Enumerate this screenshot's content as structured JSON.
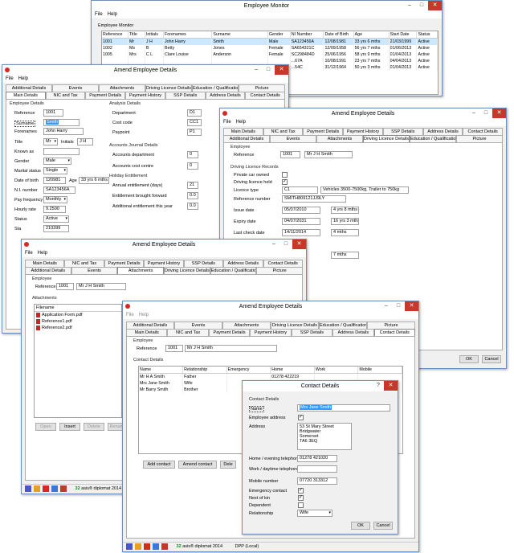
{
  "monitor": {
    "title": "Employee Monitor",
    "menu": [
      "File",
      "Help"
    ],
    "subtitle": "Employee Monitor",
    "columns": [
      "Reference",
      "Title",
      "Initials",
      "Forenames",
      "Surname",
      "Gender",
      "NI Number",
      "Date of Birth",
      "Age",
      "Start Date",
      "Status"
    ],
    "rows": [
      [
        "1001",
        "Mr",
        "J H",
        "John Harry",
        "Smith",
        "Male",
        "SA123456A",
        "12/08/1981",
        "33 yrs 6 mths",
        "21/03/1999",
        "Active"
      ],
      [
        "1002",
        "Ms",
        "B",
        "Betty",
        "Jones",
        "Female",
        "SA654321C",
        "12/09/1958",
        "56 yrs 7 mths",
        "01/06/2013",
        "Active"
      ],
      [
        "1005",
        "Mrs",
        "C L",
        "Clare Louise",
        "Anderson",
        "Female",
        "SC298484D",
        "25/06/1956",
        "58 yrs 9 mths",
        "01/04/2013",
        "Active"
      ],
      [
        "",
        "",
        "",
        "",
        "",
        "",
        "...67A",
        "10/08/1991",
        "23 yrs 7 mths",
        "04/04/2013",
        "Active"
      ],
      [
        "",
        "",
        "",
        "",
        "",
        "",
        "...54C",
        "31/12/1964",
        "50 yrs 3 mths",
        "01/04/2013",
        "Active"
      ]
    ]
  },
  "w1": {
    "title": "Amend Employee Details",
    "menu": [
      "File",
      "Help"
    ],
    "tabs1": [
      "Additional Details",
      "Events",
      "Attachments",
      "Driving Licence Details",
      "Education / Qualifications",
      "Picture"
    ],
    "tabs2": [
      "Main Details",
      "NIC and Tax",
      "Payment Details",
      "Payment History",
      "SSP Details",
      "Address Details",
      "Contact Details"
    ],
    "grp_employee": "Employee Details",
    "grp_analysis": "Analysis Details",
    "fields": [
      {
        "l": "Reference",
        "v": "1001"
      },
      {
        "l": "Surname",
        "v": "Smith"
      },
      {
        "l": "Forenames",
        "v": "John Harry"
      },
      {
        "l": "Title",
        "v": "Mr"
      },
      {
        "l": "Known as",
        "v": ""
      },
      {
        "l": "Gender",
        "v": "Male"
      },
      {
        "l": "Marital status",
        "v": "Single"
      },
      {
        "l": "Date of birth",
        "v": "120981"
      },
      {
        "l": "N.I. number",
        "v": "SA123456A"
      },
      {
        "l": "Pay frequency",
        "v": "Monthly"
      },
      {
        "l": "Hourly rate",
        "v": "9.2500"
      },
      {
        "l": "Status",
        "v": "Active"
      },
      {
        "l": "Sta",
        "v": "210399"
      }
    ],
    "initials_label": "Initials",
    "initials": "J H",
    "age_label": "Age",
    "age": "33 yrs 6 mths",
    "analysis": [
      {
        "l": "Department",
        "v": "D1"
      },
      {
        "l": "Cost code",
        "v": "CC1"
      },
      {
        "l": "Paypoint",
        "v": "P1"
      }
    ],
    "grp_journal": "Accounts Journal Details",
    "journal": [
      {
        "l": "Accounts department",
        "v": "0"
      },
      {
        "l": "Accounts cost centre",
        "v": "0"
      }
    ],
    "grp_holiday": "Holiday Entitlement",
    "holiday": [
      {
        "l": "Annual entitlement (days)",
        "v": "21"
      },
      {
        "l": "Entitlement brought forward",
        "v": "0.0"
      },
      {
        "l": "Additional entitlement this year",
        "v": "0.0"
      }
    ]
  },
  "w2": {
    "title": "Amend Employee Details",
    "menu": [
      "File",
      "Help"
    ],
    "tabs2": [
      "Main Details",
      "NIC and Tax",
      "Payment Details",
      "Payment History",
      "SSP Details",
      "Address Details",
      "Contact Details"
    ],
    "tabs1": [
      "Additional Details",
      "Events",
      "Attachments",
      "Driving Licence Details",
      "Education / Qualifications",
      "Picture"
    ],
    "grp_employee": "Employee",
    "ref_label": "Reference",
    "ref": "1001",
    "name": "Mr J H Smith",
    "grp_dl": "Driving Licence Records",
    "private_car": "Private car owned",
    "licence_held": "Driving licence held",
    "licence_type_label": "Licence type",
    "licence_type": "C1",
    "licence_desc": "Vehicles 3500-7500kg, Trailer to 750kg",
    "ref_number_label": "Reference number",
    "ref_number": "SMITH809121JJ9LY",
    "issue_label": "Issue date",
    "issue": "05/07/2010",
    "issue_age": "4 yrs 8 mths",
    "expiry_label": "Expiry date",
    "expiry": "04/07/2031",
    "expiry_age": "16 yrs 3 mths",
    "check_label": "Last check date",
    "check": "14/11/2014",
    "check_age": "4 mths",
    "extra": "7 mths",
    "ok": "OK",
    "cancel": "Cancel"
  },
  "w3": {
    "title": "Amend Employee Details",
    "menu": [
      "File",
      "Help"
    ],
    "tabs2": [
      "Main Details",
      "NIC and Tax",
      "Payment Details",
      "Payment History",
      "SSP Details",
      "Address Details",
      "Contact Details"
    ],
    "tabs1": [
      "Additional Details",
      "Events",
      "Attachments",
      "Driving Licence Details",
      "Education / Qualifications",
      "Picture"
    ],
    "grp_employee": "Employee",
    "ref_label": "Reference",
    "ref": "1001",
    "name": "Mr J H Smith",
    "grp_att": "Attachments",
    "col": "Filename",
    "files": [
      "Application Form.pdf",
      "Reference1.pdf",
      "Reference2.pdf"
    ],
    "buttons": [
      "Open",
      "Insert",
      "Delete",
      "Rename"
    ],
    "status": "32",
    "status_text": "asis® diplomat 2014"
  },
  "w4": {
    "title": "Amend Employee Details",
    "menu": [
      "File",
      "Help"
    ],
    "tabs1": [
      "Additional Details",
      "Events",
      "Attachments",
      "Driving Licence Details",
      "Education / Qualifications",
      "Picture"
    ],
    "tabs2": [
      "Main Details",
      "NIC and Tax",
      "Payment Details",
      "Payment History",
      "SSP Details",
      "Address Details",
      "Contact Details"
    ],
    "grp_employee": "Employee",
    "ref_label": "Reference",
    "ref": "1001",
    "name": "Mr J H Smith",
    "grp_contact": "Contact Details",
    "columns": [
      "Name",
      "Relationship",
      "Emergency",
      "Home",
      "Work",
      "Mobile"
    ],
    "rows": [
      [
        "Mr H A Smith",
        "Father",
        "",
        "01278 422219",
        "",
        ""
      ],
      [
        "Mrs Jane Smith",
        "Wife",
        "",
        "",
        "",
        ""
      ],
      [
        "Mr Barry Smith",
        "Brother",
        "",
        "",
        "",
        ""
      ]
    ],
    "buttons": [
      "Add contact",
      "Amend contact",
      "Dele"
    ],
    "status": "32",
    "status_text": "asis® diplomat 2014",
    "status_text2": "DPP (Local)"
  },
  "contact": {
    "title": "Contact Details",
    "group": "Contact Details",
    "name_label": "Name",
    "name": "Mrs Jane Smith",
    "emp_addr": "Employee address",
    "address_label": "Address",
    "address": [
      "53 St Mary Street",
      "Bridgwater",
      "Somerset",
      "TA6 3EQ"
    ],
    "home_label": "Home / evening telephone",
    "home": "01278 421020",
    "work_label": "Work / daytime telephone",
    "work": "",
    "mobile_label": "Mobile number",
    "mobile": "07720 313312",
    "emergency": "Emergency contact",
    "nok": "Next of kin",
    "dependent": "Dependent",
    "rel_label": "Relationship",
    "rel": "Wife",
    "ok": "OK",
    "cancel": "Cancel"
  }
}
